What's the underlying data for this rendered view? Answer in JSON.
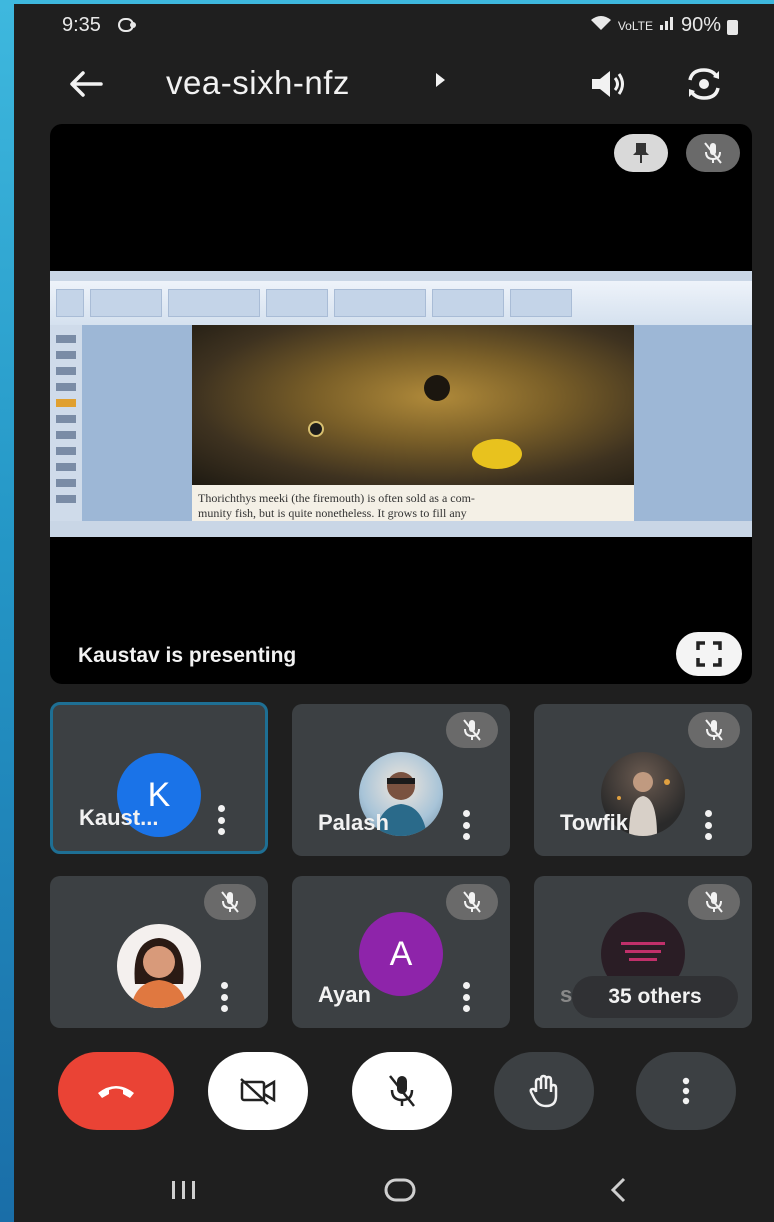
{
  "status_bar": {
    "time": "9:35",
    "battery": "90%"
  },
  "header": {
    "meeting_code": "vea-sixh-nfz"
  },
  "presentation": {
    "presenting_label": "Kaustav is presenting",
    "slide_caption": "Thorichthys meeki (the firemouth) is often sold as a com-",
    "slide_caption_2": "munity fish, but is quite nonetheless. It grows to fill any"
  },
  "participants": [
    {
      "name": "Kaust...",
      "avatar_letter": "K",
      "avatar_color": "#1a73e8",
      "muted": false,
      "active": true
    },
    {
      "name": "Palash",
      "avatar_letter": "",
      "avatar_color": "#7fa7c0",
      "muted": true,
      "active": false
    },
    {
      "name": "Towfik",
      "avatar_letter": "",
      "avatar_color": "#4a4a4a",
      "muted": true,
      "active": false
    },
    {
      "name": "",
      "avatar_letter": "",
      "avatar_color": "#c07a66",
      "muted": true,
      "active": false
    },
    {
      "name": "Ayan",
      "avatar_letter": "A",
      "avatar_color": "#8e24aa",
      "muted": true,
      "active": false
    },
    {
      "name": "sa",
      "avatar_letter": "",
      "avatar_color": "#2a1d25",
      "muted": true,
      "active": false
    }
  ],
  "others_label": "35 others",
  "colors": {
    "background": "#1f1f1f",
    "end_call": "#ea4335",
    "tile": "#3c4043",
    "active_border": "#1e6f94"
  },
  "icons": {
    "back": "arrow-left-icon",
    "speaker": "speaker-icon",
    "switch_camera": "switch-camera-icon",
    "pin": "pin-icon",
    "mic_off": "mic-off-icon",
    "fullscreen": "fullscreen-icon",
    "end_call": "phone-hangup-icon",
    "camera_off": "camera-off-icon",
    "hand": "raise-hand-icon",
    "more": "more-vertical-icon"
  }
}
